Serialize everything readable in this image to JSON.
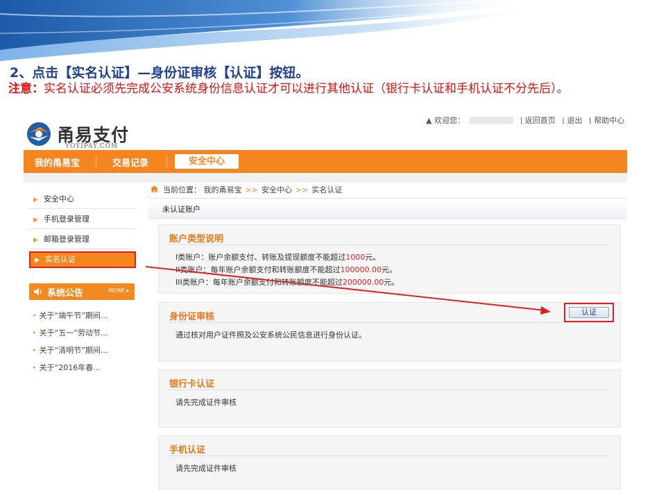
{
  "slide": {
    "title": "2、点击【实名认证】—身份证审核【认证】按钮。",
    "note_label": "注意：",
    "note_text": "实名认证必须先完成公安系统身份信息认证才可以进行其他认证（银行卡认证和手机认证不分先后）。"
  },
  "colors": {
    "orange": "#f5861f",
    "red_highlight": "#e02020",
    "title_blue": "#1f3f8f"
  },
  "site": {
    "logo_text": "甬易支付",
    "logo_sub": "YOYIPAY.COM",
    "top_links": {
      "welcome": "▲ 欢迎您：",
      "home": "| 返回首页",
      "logout": "| 退出",
      "help": "| 帮助中心"
    }
  },
  "nav": {
    "items": [
      "我的甬易宝",
      "交易记录"
    ],
    "active": "安全中心"
  },
  "sidebar": {
    "items": [
      "安全中心",
      "手机登录管理",
      "邮箱登录管理",
      "实名认证"
    ],
    "notice_title": "系统公告",
    "notice_more": "MORE ▸",
    "notices": [
      "关于“端午节”期间...",
      "关于“五一”劳动节...",
      "关于“清明节”期间...",
      "关于“2016年春..."
    ]
  },
  "breadcrumb": {
    "label": "当前位置：",
    "parts": [
      "我的甬易宝",
      "安全中心",
      "实名认证"
    ],
    "sep": ">>"
  },
  "account_header": "未认证账户",
  "panels": {
    "type": {
      "title": "账户类型说明",
      "line1_pre": "I类账户：账户余额支付、转账及提现额度不能超过",
      "line1_amt": "1000",
      "line1_post": "元。",
      "line2_pre": "II类账户：每年账户余额支付和转账额度不能超过",
      "line2_amt": "100000.00",
      "line2_post": "元。",
      "line3_pre": "III类账户：每年账户余额支付和转账额度不能超过",
      "line3_amt": "200000.00",
      "line3_post": "元。"
    },
    "id": {
      "title": "身份证审核",
      "text": "通过核对用户证件照及公安系统公民信息进行身份认证。",
      "button": "认证"
    },
    "bank": {
      "title": "银行卡认证",
      "text": "请先完成证件审核"
    },
    "phone": {
      "title": "手机认证",
      "text": "请先完成证件审核"
    }
  }
}
